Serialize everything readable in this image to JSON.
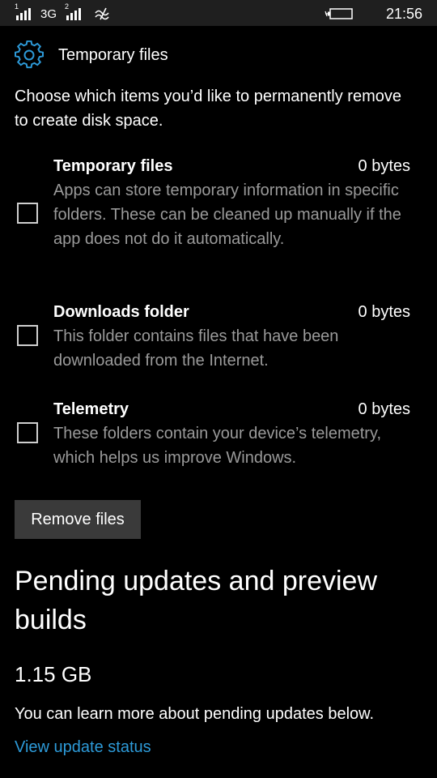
{
  "status_bar": {
    "sim1_label": "1",
    "sim2_label": "2",
    "network_type": "3G",
    "time": "21:56",
    "icons": [
      "signal-icon",
      "signal-icon",
      "nfc-icon",
      "battery-icon"
    ]
  },
  "header": {
    "title": "Temporary files",
    "icon": "gear-icon"
  },
  "intro": "Choose which items you’d like to permanently remove to create disk space.",
  "items": [
    {
      "title": "Temporary files",
      "size": "0 bytes",
      "description": "Apps can store temporary information in specific folders. These can be cleaned up manually if the app does not do it automatically.",
      "checked": false
    },
    {
      "title": "Downloads folder",
      "size": "0 bytes",
      "description": "This folder contains files that have been downloaded from the Internet.",
      "checked": false
    },
    {
      "title": "Telemetry",
      "size": "0 bytes",
      "description": "These folders contain your device’s telemetry, which helps us improve Windows.",
      "checked": false
    }
  ],
  "remove_button_label": "Remove files",
  "pending": {
    "heading": "Pending updates and preview builds",
    "size": "1.15 GB",
    "description": "You can learn more about pending updates below.",
    "link_label": "View update status"
  },
  "colors": {
    "background": "#000000",
    "status_bar": "#1f1f1f",
    "accent": "#2d9ad8",
    "secondary_text": "#9a9a9a",
    "button": "#3a3a3a"
  }
}
